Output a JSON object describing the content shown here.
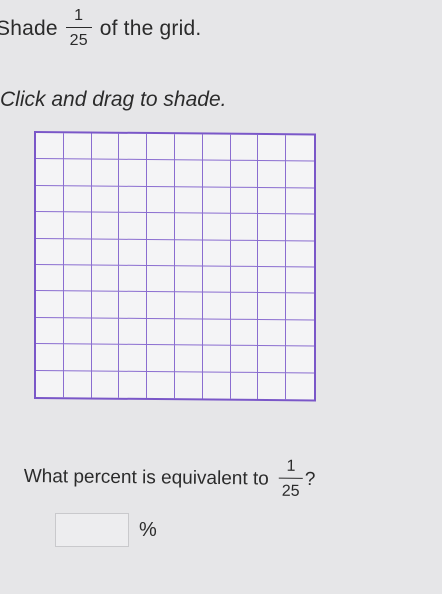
{
  "prompt": {
    "before": "Shade",
    "fraction": {
      "numerator": "1",
      "denominator": "25"
    },
    "after": "of the grid."
  },
  "instruction": "Click and drag to shade.",
  "grid": {
    "rows": 10,
    "columns": 10,
    "border_color": "#7a57c8",
    "shaded_cells": 0
  },
  "question": {
    "text": "What percent is equivalent to",
    "fraction": {
      "numerator": "1",
      "denominator": "25"
    },
    "suffix": "?"
  },
  "answer": {
    "value": "",
    "unit": "%"
  }
}
